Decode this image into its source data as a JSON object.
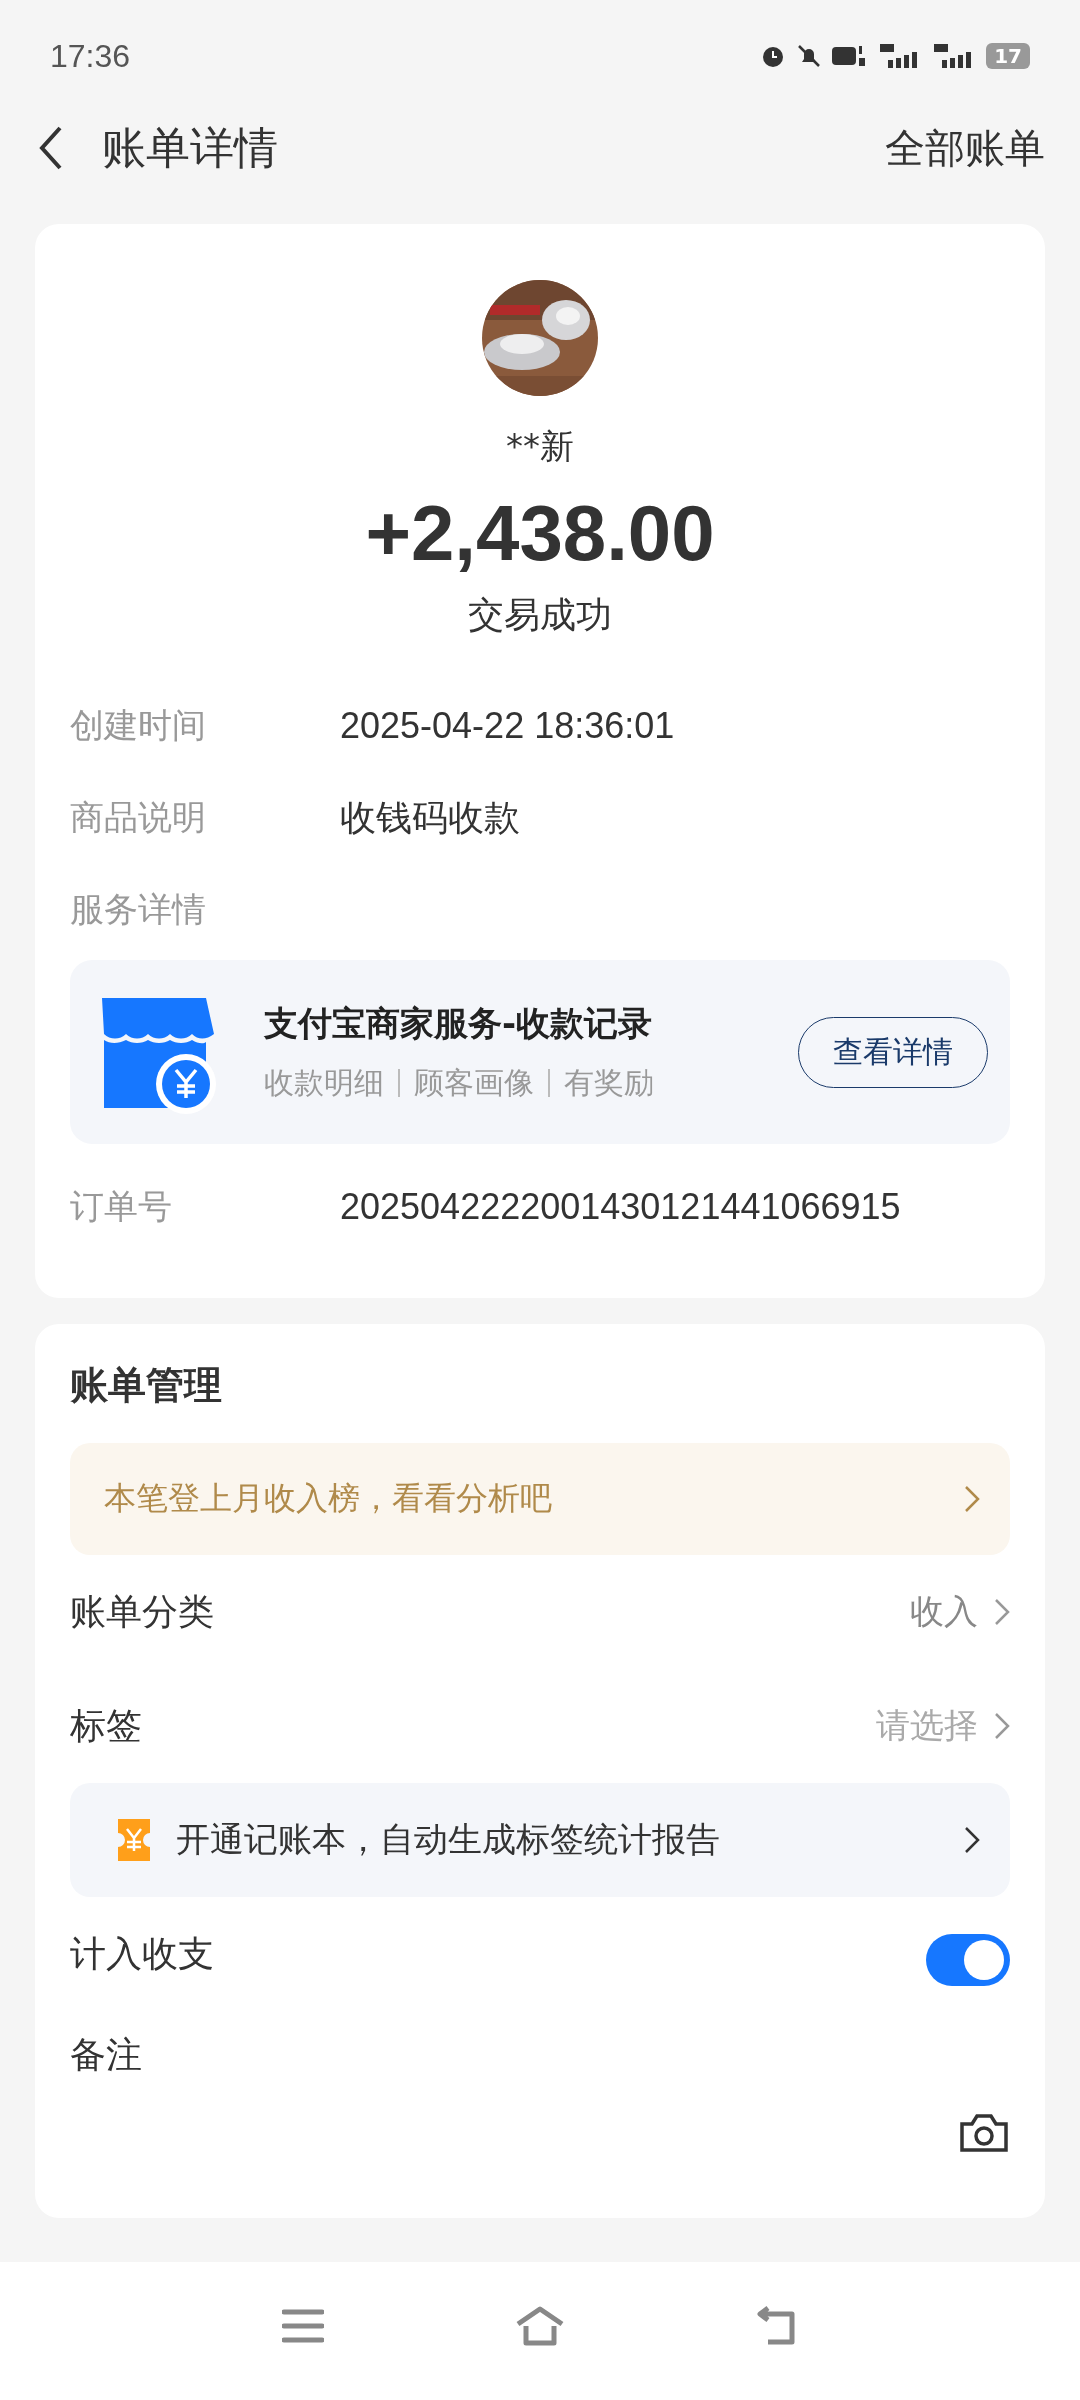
{
  "status_bar": {
    "time": "17:36",
    "battery": "17"
  },
  "header": {
    "title": "账单详情",
    "action": "全部账单"
  },
  "summary": {
    "name": "**新",
    "amount": "+2,438.00",
    "status": "交易成功"
  },
  "details": [
    {
      "label": "创建时间",
      "value": "2025-04-22 18:36:01"
    },
    {
      "label": "商品说明",
      "value": "收钱码收款"
    }
  ],
  "service": {
    "label": "服务详情",
    "title": "支付宝商家服务-收款记录",
    "features": [
      "收款明细",
      "顾客画像",
      "有奖励"
    ],
    "button": "查看详情"
  },
  "order": {
    "label": "订单号",
    "value": "2025042222001430121441066915"
  },
  "management": {
    "title": "账单管理",
    "banner": "本笔登上月收入榜，看看分析吧",
    "rows": [
      {
        "label": "账单分类",
        "value": "收入",
        "placeholder": false
      },
      {
        "label": "标签",
        "value": "请选择",
        "placeholder": true
      }
    ],
    "promo": "开通记账本，自动生成标签统计报告",
    "toggle": {
      "label": "计入收支",
      "on": true
    },
    "remark": {
      "label": "备注"
    }
  }
}
